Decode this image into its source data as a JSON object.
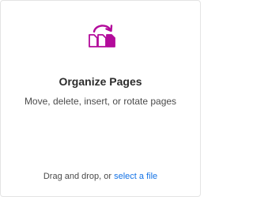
{
  "card": {
    "icon": "organize-pages-icon",
    "accent_color": "#b30b9b",
    "title": "Organize Pages",
    "description": "Move, delete, insert, or rotate pages",
    "drop_text": "Drag and drop, or ",
    "select_link": "select a file",
    "link_color": "#1473e6"
  }
}
